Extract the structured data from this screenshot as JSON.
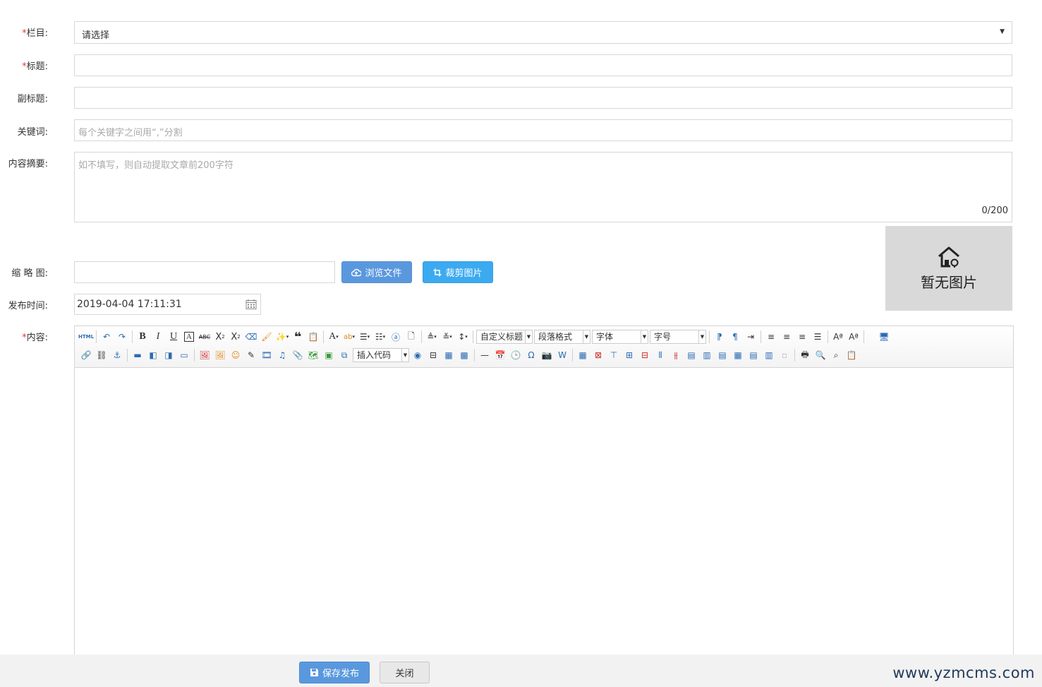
{
  "form": {
    "category": {
      "label": "栏目:",
      "required": "*",
      "value": "请选择"
    },
    "title": {
      "label": "标题:",
      "required": "*"
    },
    "subtitle": {
      "label": "副标题:"
    },
    "keywords": {
      "label": "关键词:",
      "placeholder": "每个关键字之间用“,”分割"
    },
    "summary": {
      "label": "内容摘要:",
      "placeholder": "如不填写，则自动提取文章前200字符",
      "counter": "0/200"
    },
    "thumbnail": {
      "label": "缩 略 图:",
      "browse_label": "浏览文件",
      "crop_label": "裁剪图片",
      "preview_text": "暂无图片"
    },
    "publish_time": {
      "label": "发布时间:",
      "value": "2019-04-04 17:11:31"
    },
    "content": {
      "label": "内容:",
      "required": "*"
    }
  },
  "editor": {
    "combos": {
      "custom_title": "自定义标题",
      "paragraph": "段落格式",
      "font": "字体",
      "size": "字号",
      "insert_code": "插入代码"
    },
    "icons_row1": [
      "html-icon",
      "undo-icon",
      "redo-icon",
      "bold-icon",
      "italic-icon",
      "underline-icon",
      "font-border-icon",
      "strikethrough-icon",
      "superscript-icon",
      "subscript-icon",
      "remove-format-icon",
      "format-match-icon",
      "auto-typeset-icon",
      "blockquote-icon",
      "paste-plain-icon",
      "forecolor-icon",
      "backcolor-icon",
      "ordered-list-icon",
      "unordered-list-icon",
      "select-all-icon",
      "clear-doc-icon",
      "row-spacing-top-icon",
      "row-spacing-bottom-icon",
      "line-height-icon",
      "ltr-icon",
      "rtl-icon",
      "indent-icon",
      "justify-left-icon",
      "justify-center-icon",
      "justify-right-icon",
      "justify-full-icon",
      "touppercase-icon",
      "tolowercase-icon",
      "fullscreen-icon"
    ],
    "icons_row2": [
      "link-icon",
      "unlink-icon",
      "anchor-icon",
      "image-none-icon",
      "image-left-icon",
      "image-right-icon",
      "image-center-icon",
      "simple-upload-icon",
      "insert-image-icon",
      "emotion-icon",
      "scrawl-icon",
      "insert-video-icon",
      "music-icon",
      "attachment-icon",
      "map-icon",
      "gmap-icon",
      "insert-frame-icon",
      "webapp-icon",
      "pagebreak-icon",
      "template-icon",
      "background-icon",
      "horizontal-icon",
      "date-icon",
      "time-icon",
      "spechars-icon",
      "snapscreen-icon",
      "wordimage-icon",
      "insert-table-icon",
      "delete-table-icon",
      "insert-paragraph-before-table-icon",
      "insert-row-icon",
      "delete-row-icon",
      "insert-col-icon",
      "delete-col-icon",
      "merge-cells-icon",
      "merge-right-icon",
      "merge-down-icon",
      "split-to-cells-icon",
      "split-to-rows-icon",
      "split-to-cols-icon",
      "charts-icon",
      "print-icon",
      "preview-icon",
      "search-replace-icon",
      "drafts-icon"
    ]
  },
  "footer": {
    "save_label": "保存发布",
    "close_label": "关闭",
    "brand": "www.yzmcms.com"
  },
  "colors": {
    "primary": "#5a98de",
    "crop": "#3caaf0",
    "required": "#e4393c"
  }
}
